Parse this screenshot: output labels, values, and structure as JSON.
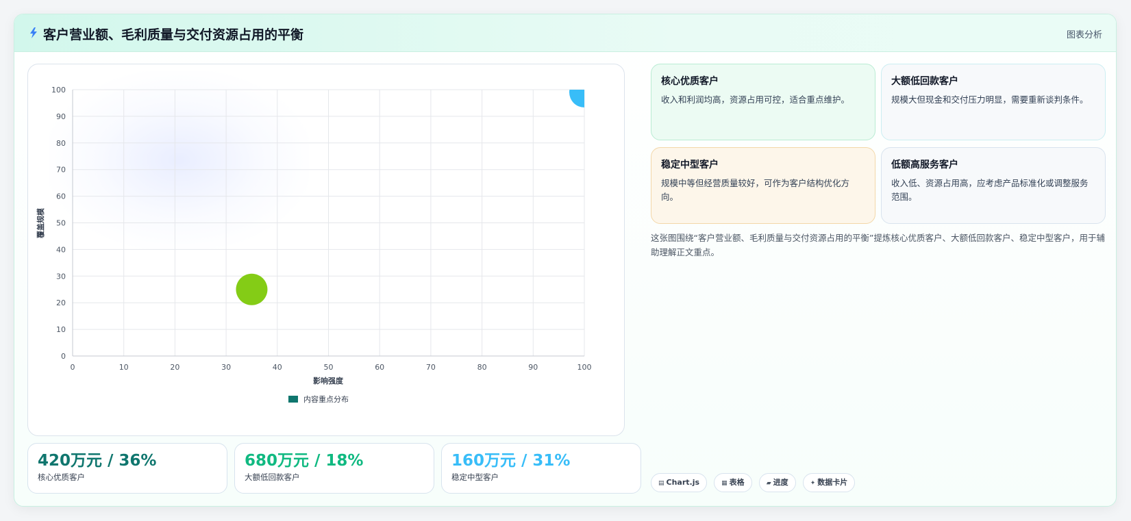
{
  "header": {
    "title": "客户营业额、毛利质量与交付资源占用的平衡",
    "tag": "图表分析"
  },
  "chart_data": {
    "type": "scatter",
    "xlabel": "影响强度",
    "ylabel": "覆盖规模",
    "xlim": [
      0,
      100
    ],
    "ylim": [
      0,
      100
    ],
    "xticks": [
      "0",
      "10",
      "20",
      "30",
      "40",
      "50",
      "60",
      "70",
      "80",
      "90",
      "100"
    ],
    "yticks": [
      "0",
      "10",
      "20",
      "30",
      "40",
      "50",
      "60",
      "70",
      "80",
      "90",
      "100"
    ],
    "grid": true,
    "legend_position": "bottom",
    "legend": [
      {
        "label": "内容重点分布",
        "color": "#0f766e"
      }
    ],
    "points": [
      {
        "x": 35,
        "y": 25,
        "r": 23,
        "color": "#84cc16"
      },
      {
        "x": 100,
        "y": 99,
        "r": 22,
        "color": "#38bdf8"
      }
    ]
  },
  "cards": [
    {
      "title": "核心优质客户",
      "desc": "收入和利润均高，资源占用可控，适合重点维护。"
    },
    {
      "title": "大额低回款客户",
      "desc": "规模大但现金和交付压力明显，需要重新谈判条件。"
    },
    {
      "title": "稳定中型客户",
      "desc": "规模中等但经营质量较好，可作为客户结构优化方向。"
    },
    {
      "title": "低额高服务客户",
      "desc": "收入低、资源占用高，应考虑产品标准化或调整服务范围。"
    }
  ],
  "summary": "这张图围绕“客户营业额、毛利质量与交付资源占用的平衡”提炼核心优质客户、大额低回款客户、稳定中型客户，用于辅助理解正文重点。",
  "stats": [
    {
      "value": "420万元 / 36%",
      "label": "核心优质客户",
      "color": "#0f766e"
    },
    {
      "value": "680万元 / 18%",
      "label": "大额低回款客户",
      "color": "#10b981"
    },
    {
      "value": "160万元 / 31%",
      "label": "稳定中型客户",
      "color": "#38bdf8"
    }
  ],
  "chips": [
    {
      "icon": "▤",
      "icon_name": "chart-icon",
      "label": "Chart.js"
    },
    {
      "icon": "▦",
      "icon_name": "table-icon",
      "label": "表格"
    },
    {
      "icon": "▰",
      "icon_name": "progress-icon",
      "label": "进度"
    },
    {
      "icon": "✦",
      "icon_name": "sparkle-icon",
      "label": "数据卡片"
    }
  ]
}
